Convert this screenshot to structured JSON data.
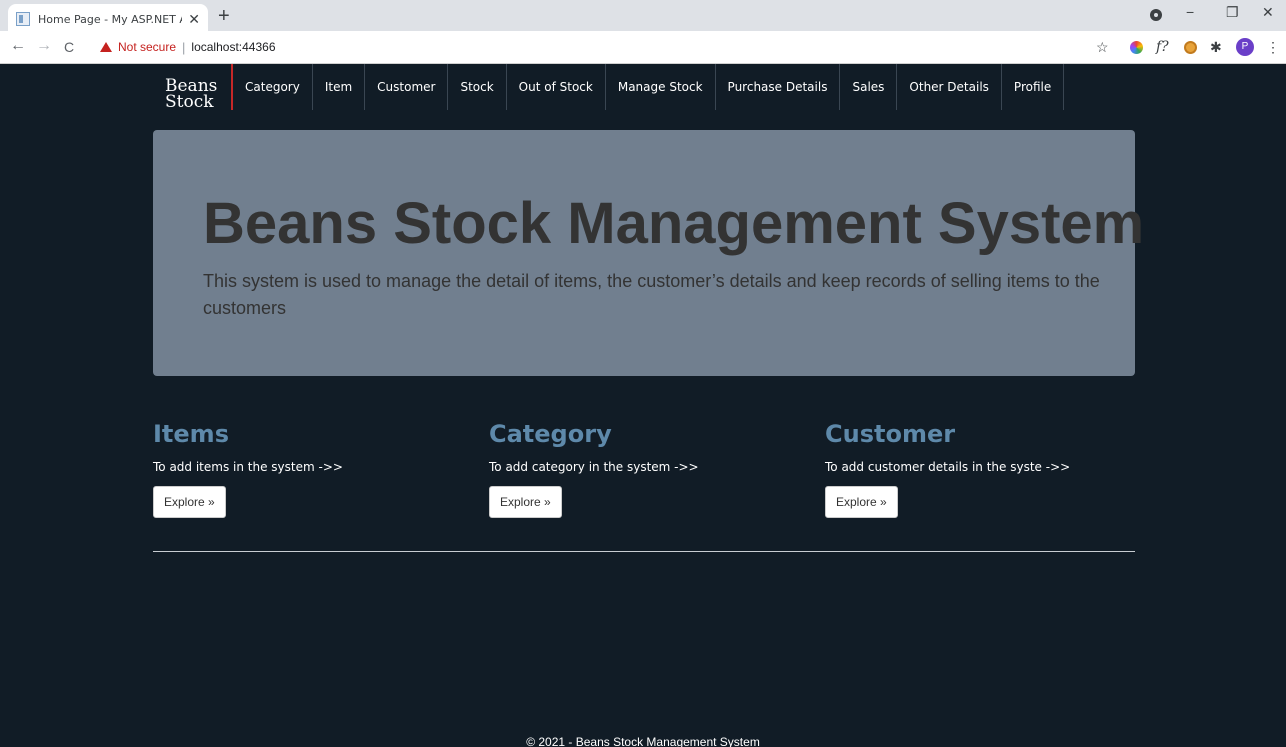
{
  "browser": {
    "tab_title": "Home Page - My ASP.NET Applic",
    "tab_close": "✕",
    "new_tab": "+",
    "not_secure": "Not secure",
    "separator": "|",
    "url": "localhost:44366",
    "avatar_letter": "P",
    "ext_f": "f?",
    "minimize": "−",
    "restore": "❐",
    "close": "✕",
    "back": "←",
    "forward": "→",
    "reload": "C",
    "star": "☆",
    "puzzle": "✱",
    "menu": "⋮"
  },
  "nav": {
    "brand_line1": "Beans",
    "brand_line2": "Stock",
    "items": [
      "Category",
      "Item",
      "Customer",
      "Stock",
      "Out of Stock",
      "Manage Stock",
      "Purchase Details",
      "Sales",
      "Other Details",
      "Profile"
    ]
  },
  "jumbotron": {
    "title": "Beans Stock Management System",
    "description": "This system is used to manage the detail of items, the customer’s details and keep records of selling items to the customers"
  },
  "columns": [
    {
      "heading": "Items",
      "text": "To add items in the system ->>",
      "button": "Explore »"
    },
    {
      "heading": "Category",
      "text": "To add category in the system ->>",
      "button": "Explore »"
    },
    {
      "heading": "Customer",
      "text": "To add customer details in the syste ->>",
      "button": "Explore »"
    }
  ],
  "footer": "© 2021 - Beans Stock Management System",
  "colors": {
    "page_bg": "#111c26",
    "jumbotron_bg": "#717f8f",
    "heading_accent": "#5e89aa",
    "brand_divider": "#c62828"
  }
}
